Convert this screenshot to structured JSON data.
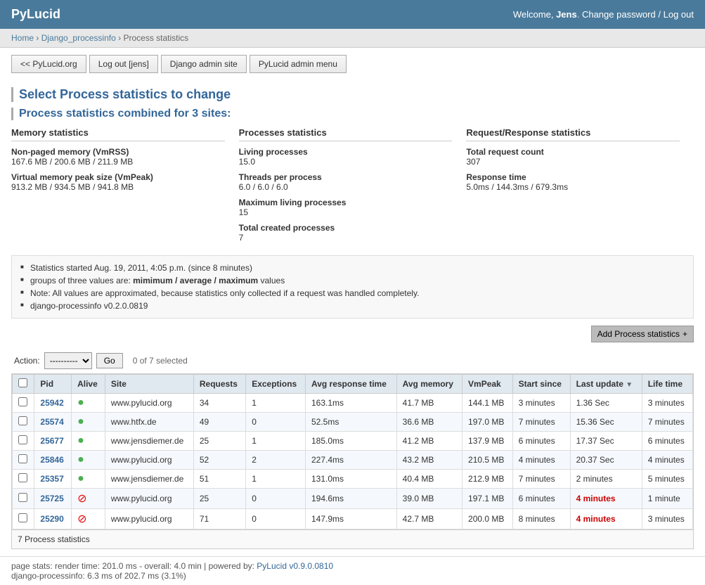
{
  "header": {
    "logo": "PyLucid",
    "welcome": "Welcome,",
    "username": "Jens",
    "change_password": "Change password",
    "separator": "/",
    "logout": "Log out"
  },
  "breadcrumb": {
    "home": "Home",
    "django_processinfo": "Django_processinfo",
    "current": "Process statistics"
  },
  "nav": {
    "buttons": [
      {
        "label": "<< PyLucid.org",
        "name": "pylucid-btn"
      },
      {
        "label": "Log out [jens]",
        "name": "logout-btn"
      },
      {
        "label": "Django admin site",
        "name": "django-admin-btn"
      },
      {
        "label": "PyLucid admin menu",
        "name": "pylucid-admin-btn"
      }
    ]
  },
  "page": {
    "title": "Select Process statistics to change",
    "combined_title": "Process statistics combined for 3 sites:"
  },
  "stats": {
    "memory": {
      "heading": "Memory statistics",
      "items": [
        {
          "label": "Non-paged memory (VmRSS)",
          "value": "167.6 MB / 200.6 MB / 211.9 MB"
        },
        {
          "label": "Virtual memory peak size (VmPeak)",
          "value": "913.2 MB / 934.5 MB / 941.8 MB"
        }
      ]
    },
    "processes": {
      "heading": "Processes statistics",
      "items": [
        {
          "label": "Living processes",
          "value": "15.0"
        },
        {
          "label": "Threads per process",
          "value": "6.0 / 6.0 / 6.0"
        },
        {
          "label": "Maximum living processes",
          "value": "15"
        },
        {
          "label": "Total created processes",
          "value": "7"
        }
      ]
    },
    "request_response": {
      "heading": "Request/Response statistics",
      "items": [
        {
          "label": "Total request count",
          "value": "307"
        },
        {
          "label": "Response time",
          "value": "5.0ms / 144.3ms / 679.3ms"
        }
      ]
    }
  },
  "notes": {
    "items": [
      "Statistics started Aug. 19, 2011, 4:05 p.m. (since 8 minutes)",
      "groups of three values are: mimimum / average / maximum values",
      "Note: All values are approximated, because statistics only collected if a request was handled completely.",
      "django-processinfo v0.2.0.0819"
    ],
    "bold_phrases": [
      "mimimum / average / maximum"
    ]
  },
  "action_bar": {
    "label": "Action:",
    "select_default": "----------",
    "go_label": "Go",
    "selected": "0 of 7 selected"
  },
  "add_button": {
    "label": "Add Process statistics",
    "plus": "+"
  },
  "table": {
    "columns": [
      "Pid",
      "Alive",
      "Site",
      "Requests",
      "Exceptions",
      "Avg response time",
      "Avg memory",
      "VmPeak",
      "Start since",
      "Last update",
      "Life time"
    ],
    "rows": [
      {
        "pid": "25942",
        "alive": true,
        "site": "www.pylucid.org",
        "requests": "34",
        "exceptions": "1",
        "avg_response": "163.1ms",
        "avg_memory": "41.7 MB",
        "vmpeak": "144.1 MB",
        "start_since": "3 minutes",
        "last_update": "1.36 Sec",
        "last_update_warn": false,
        "life_time": "3 minutes"
      },
      {
        "pid": "25574",
        "alive": true,
        "site": "www.htfx.de",
        "requests": "49",
        "exceptions": "0",
        "avg_response": "52.5ms",
        "avg_memory": "36.6 MB",
        "vmpeak": "197.0 MB",
        "start_since": "7 minutes",
        "last_update": "15.36 Sec",
        "last_update_warn": false,
        "life_time": "7 minutes"
      },
      {
        "pid": "25677",
        "alive": true,
        "site": "www.jensdiemer.de",
        "requests": "25",
        "exceptions": "1",
        "avg_response": "185.0ms",
        "avg_memory": "41.2 MB",
        "vmpeak": "137.9 MB",
        "start_since": "6 minutes",
        "last_update": "17.37 Sec",
        "last_update_warn": false,
        "life_time": "6 minutes"
      },
      {
        "pid": "25846",
        "alive": true,
        "site": "www.pylucid.org",
        "requests": "52",
        "exceptions": "2",
        "avg_response": "227.4ms",
        "avg_memory": "43.2 MB",
        "vmpeak": "210.5 MB",
        "start_since": "4 minutes",
        "last_update": "20.37 Sec",
        "last_update_warn": false,
        "life_time": "4 minutes"
      },
      {
        "pid": "25357",
        "alive": true,
        "site": "www.jensdiemer.de",
        "requests": "51",
        "exceptions": "1",
        "avg_response": "131.0ms",
        "avg_memory": "40.4 MB",
        "vmpeak": "212.9 MB",
        "start_since": "7 minutes",
        "last_update": "2 minutes",
        "last_update_warn": false,
        "life_time": "5 minutes"
      },
      {
        "pid": "25725",
        "alive": false,
        "site": "www.pylucid.org",
        "requests": "25",
        "exceptions": "0",
        "avg_response": "194.6ms",
        "avg_memory": "39.0 MB",
        "vmpeak": "197.1 MB",
        "start_since": "6 minutes",
        "last_update": "4 minutes",
        "last_update_warn": true,
        "life_time": "1 minute"
      },
      {
        "pid": "25290",
        "alive": false,
        "site": "www.pylucid.org",
        "requests": "71",
        "exceptions": "0",
        "avg_response": "147.9ms",
        "avg_memory": "42.7 MB",
        "vmpeak": "200.0 MB",
        "start_since": "8 minutes",
        "last_update": "4 minutes",
        "last_update_warn": true,
        "life_time": "3 minutes"
      }
    ],
    "footer": "7 Process statistics"
  },
  "page_stats": {
    "render_time": "page stats: render time: 201.0 ms - overall: 4.0 min | powered by:",
    "link_label": "PyLucid v0.9.0.0810",
    "django_info": "django-processinfo: 6.3 ms of 202.7 ms (3.1%)"
  }
}
